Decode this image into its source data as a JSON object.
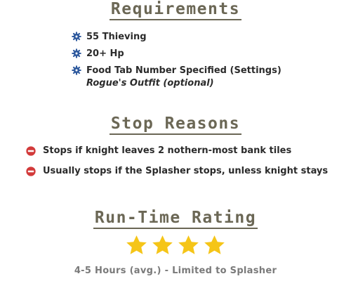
{
  "requirements": {
    "title": "Requirements",
    "items": [
      {
        "icon": "gear-icon",
        "label": "55 Thieving"
      },
      {
        "icon": "gear-icon",
        "label": "20+ Hp"
      },
      {
        "icon": "gear-icon",
        "label": "Food Tab Number Specified (Settings)"
      }
    ],
    "note": "Rogue's Outfit (optional)"
  },
  "stop_reasons": {
    "title": "Stop Reasons",
    "items": [
      {
        "icon": "no-entry-icon",
        "label": "Stops if knight leaves 2 nothern-most bank tiles"
      },
      {
        "icon": "no-entry-icon",
        "label": "Usually stops if the Splasher stops, unless knight stays"
      }
    ]
  },
  "run_time": {
    "title": "Run-Time Rating",
    "rating": 4,
    "rating_max": 4,
    "description": "4-5 Hours (avg.) - Limited to Splasher"
  },
  "colors": {
    "heading": "#6b6755",
    "gear_icon": "#2f5a9e",
    "no_entry_icon": "#d23a3a",
    "star": "#f5c518",
    "body_text": "#2b2b2b",
    "muted_text": "#7a7a7a"
  }
}
